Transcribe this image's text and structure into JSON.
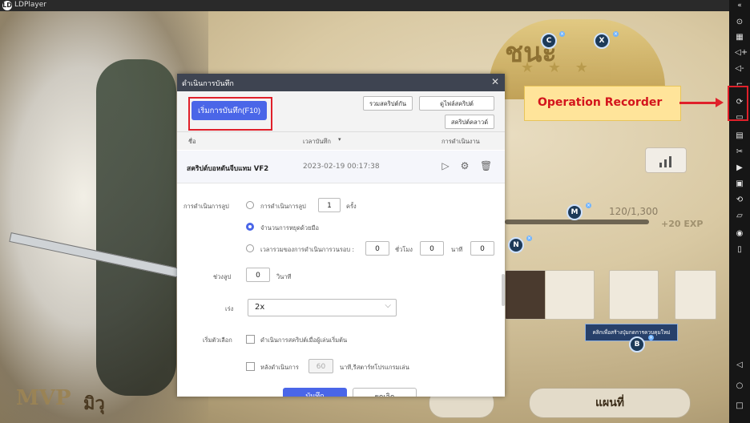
{
  "app": {
    "title": "LDPlayer",
    "logo": "LD"
  },
  "annotation": {
    "label": "Operation Recorder"
  },
  "dialog": {
    "title": "ดำเนินการบันทึก",
    "start_button": "เริ่มการบันทึก(F10)",
    "merge_button": "รวมสคริปต์กัน",
    "folder_button": "ดูไฟล์สคริปต์",
    "cloud_button": "สคริปต์คลาวด์",
    "columns": {
      "name": "ชื่อ",
      "time": "เวลาบันทึก",
      "actions": "การดำเนินงาน"
    },
    "row": {
      "name": "สคริปต์บอหดันจีบแทม VF2",
      "time": "2023-02-19 00:17:38"
    },
    "loop": {
      "label": "การดำเนินการลูป",
      "opt1": "การดำเนินการลูป",
      "opt1_value": "1",
      "opt1_unit": "ครั้ง",
      "opt2": "จำนวนการหยุดด้วยมือ",
      "opt3": "เวลารวมของการดำเนินการวนรอบ :",
      "h_value": "0",
      "h_unit": "ชั่วโมง",
      "m_value": "0",
      "m_unit": "นาที",
      "s_value": "0"
    },
    "interval": {
      "label": "ช่วงลูป",
      "value": "0",
      "unit": "วินาที"
    },
    "speed": {
      "label": "เร่ง",
      "value": "2x"
    },
    "options": {
      "label": "เริ่มตัวเลือก",
      "opt1": "ดำเนินการสคริปต์เมื่อผู้เล่นเริ่มต้น",
      "opt2_prefix": "หลังดำเนินการ",
      "opt2_value": "60",
      "opt2_suffix": "นาที,รีสตาร์ทโปรแกรมเล่น"
    },
    "footer": {
      "save": "บันทึก",
      "cancel": "ยกเลิก"
    }
  },
  "game": {
    "exp_progress": "120/1,300",
    "exp_bonus": "+20 EXP",
    "keys": [
      "C",
      "X",
      "M",
      "N",
      "B"
    ],
    "tooltip": "คลิกเพื่อสร้างปุ่มกดการควบคุมใหม่",
    "bottom_button": "แผนที่",
    "emblem": "ชนะ",
    "mvp_text": "MVP",
    "mvp_name": "มิวุ"
  },
  "sidebar_icons": [
    "keyboard-icon",
    "grid-icon",
    "volume-up-icon",
    "volume-down-icon",
    "fullscreen-icon",
    "operation-recorder-icon",
    "screenshot-icon",
    "macro-icon",
    "scissors-icon",
    "video-icon",
    "apk-icon",
    "rotate-icon",
    "folder-icon",
    "location-icon",
    "shake-icon",
    "back-icon",
    "home-icon",
    "recent-icon"
  ]
}
